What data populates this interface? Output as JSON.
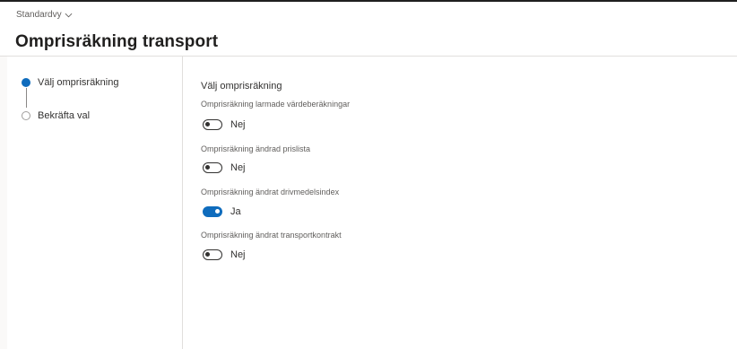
{
  "header": {
    "view_selector": "Standardvy",
    "title": "Omprisräkning transport"
  },
  "steps": [
    {
      "label": "Välj omprisräkning",
      "state": "active"
    },
    {
      "label": "Bekräfta val",
      "state": "pending"
    }
  ],
  "content": {
    "section_title": "Välj omprisräkning",
    "fields": [
      {
        "label": "Omprisräkning larmade värdeberäkningar",
        "value": "Nej",
        "on": false
      },
      {
        "label": "Omprisräkning ändrad prislista",
        "value": "Nej",
        "on": false
      },
      {
        "label": "Omprisräkning ändrat drivmedelsindex",
        "value": "Ja",
        "on": true
      },
      {
        "label": "Omprisräkning ändrat transportkontrakt",
        "value": "Nej",
        "on": false
      }
    ]
  },
  "colors": {
    "accent": "#0f6cbd",
    "text": "#323130",
    "muted": "#605e5c"
  }
}
